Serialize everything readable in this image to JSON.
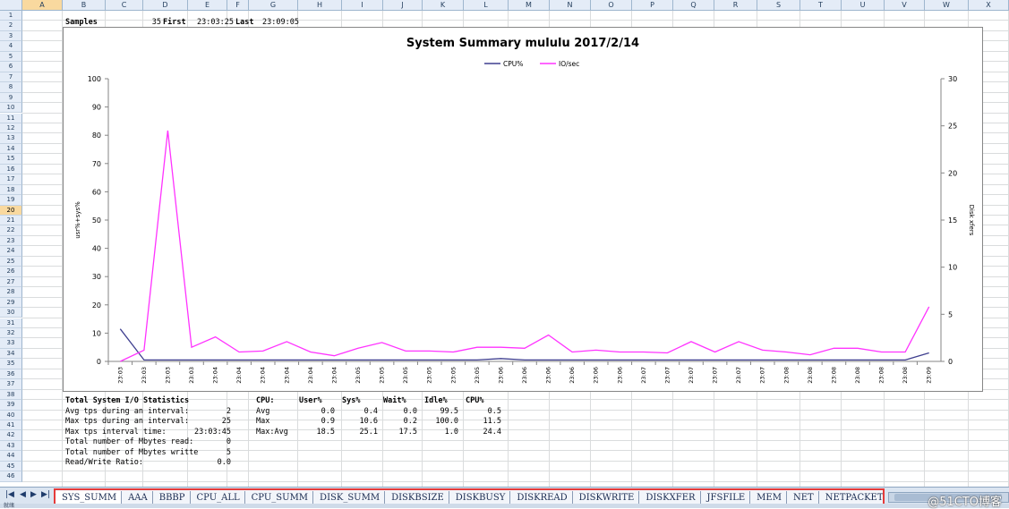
{
  "columns": [
    "A",
    "B",
    "C",
    "D",
    "E",
    "F",
    "G",
    "H",
    "I",
    "J",
    "K",
    "L",
    "M",
    "N",
    "O",
    "P",
    "Q",
    "R",
    "S",
    "T",
    "U",
    "V",
    "W",
    "X"
  ],
  "rows": [
    "1",
    "2",
    "3",
    "4",
    "5",
    "6",
    "7",
    "8",
    "9",
    "10",
    "11",
    "12",
    "13",
    "14",
    "15",
    "16",
    "17",
    "18",
    "19",
    "20",
    "21",
    "22",
    "23",
    "24",
    "25",
    "26",
    "27",
    "28",
    "29",
    "30",
    "31",
    "32",
    "33",
    "34",
    "35",
    "36",
    "37",
    "38",
    "39",
    "40",
    "41",
    "42",
    "43",
    "44",
    "45",
    "46"
  ],
  "selected_column": "A",
  "selected_row": "20",
  "header_row": {
    "samples_label": "Samples",
    "samples_value": "35",
    "first_label": "First",
    "first_value": "23:03:25",
    "last_label": "Last",
    "last_value": "23:09:05"
  },
  "chart_data": {
    "type": "line",
    "title": "System Summary mululu  2017/2/14",
    "ylabel": "usr%+sys%",
    "y2label": "Disk xfers",
    "ylim": [
      0,
      100
    ],
    "y2lim": [
      0,
      30
    ],
    "y_ticks": [
      "0",
      "10",
      "20",
      "30",
      "40",
      "50",
      "60",
      "70",
      "80",
      "90",
      "100"
    ],
    "y2_ticks": [
      "0",
      "5",
      "10",
      "15",
      "20",
      "25",
      "30"
    ],
    "legend_position": "top-center",
    "categories": [
      "23:03",
      "23:03",
      "23:03",
      "23:03",
      "23:04",
      "23:04",
      "23:04",
      "23:04",
      "23:04",
      "23:04",
      "23:05",
      "23:05",
      "23:05",
      "23:05",
      "23:05",
      "23:05",
      "23:06",
      "23:06",
      "23:06",
      "23:06",
      "23:06",
      "23:06",
      "23:07",
      "23:07",
      "23:07",
      "23:07",
      "23:07",
      "23:07",
      "23:08",
      "23:08",
      "23:08",
      "23:08",
      "23:08",
      "23:08",
      "23:09"
    ],
    "series": [
      {
        "name": "CPU%",
        "axis": "left",
        "color": "#3f3f8f",
        "values": [
          11.5,
          0.5,
          0.5,
          0.5,
          0.5,
          0.5,
          0.5,
          0.5,
          0.5,
          0.5,
          0.5,
          0.5,
          0.5,
          0.5,
          0.5,
          0.5,
          1.0,
          0.5,
          0.5,
          0.5,
          0.5,
          0.5,
          0.5,
          0.5,
          0.5,
          0.5,
          0.5,
          0.5,
          0.5,
          0.5,
          0.5,
          0.5,
          0.5,
          0.5,
          3.0
        ]
      },
      {
        "name": "IO/sec",
        "axis": "right",
        "color": "#ff33ff",
        "values": [
          0,
          1.2,
          24.5,
          1.5,
          2.6,
          1.0,
          1.1,
          2.1,
          1.0,
          0.6,
          1.4,
          2.0,
          1.1,
          1.1,
          1.0,
          1.5,
          1.5,
          1.4,
          2.8,
          1.0,
          1.2,
          1.0,
          1.0,
          0.9,
          2.1,
          1.0,
          2.1,
          1.2,
          1.0,
          0.7,
          1.4,
          1.4,
          1.0,
          1.0,
          5.8
        ]
      }
    ]
  },
  "io_stats": {
    "title": "Total System I/O Statistics",
    "rows": [
      {
        "label": "Avg tps during an interval:",
        "value": "2"
      },
      {
        "label": "Max tps during an interval:",
        "value": "25"
      },
      {
        "label": "Max tps interval time:",
        "value": "23:03:45"
      },
      {
        "label": "Total number of Mbytes read:",
        "value": "0"
      },
      {
        "label": "Total number of Mbytes writte",
        "value": "5"
      },
      {
        "label": "Read/Write Ratio:",
        "value": "0.0"
      }
    ]
  },
  "cpu_stats": {
    "headers": [
      "CPU:",
      "User%",
      "Sys%",
      "Wait%",
      "Idle%",
      "CPU%"
    ],
    "rows": [
      [
        "Avg",
        "0.0",
        "0.4",
        "0.0",
        "99.5",
        "0.5"
      ],
      [
        "Max",
        "0.9",
        "10.6",
        "0.2",
        "100.0",
        "11.5"
      ],
      [
        "Max:Avg",
        "18.5",
        "25.1",
        "17.5",
        "1.0",
        "24.4"
      ]
    ]
  },
  "sheet_tabs": [
    "SYS_SUMM",
    "AAA",
    "BBBP",
    "CPU_ALL",
    "CPU_SUMM",
    "DISK_SUMM",
    "DISKBSIZE",
    "DISKBUSY",
    "DISKREAD",
    "DISKWRITE",
    "DISKXFER",
    "JFSFILE",
    "MEM",
    "NET",
    "NETPACKET"
  ],
  "active_tab": "SYS_SUMM",
  "nav_buttons": {
    "first": "|◀",
    "prev": "◀",
    "next": "▶",
    "last": "▶|"
  },
  "watermark": "@51CTO博客",
  "status_text": "就绪"
}
